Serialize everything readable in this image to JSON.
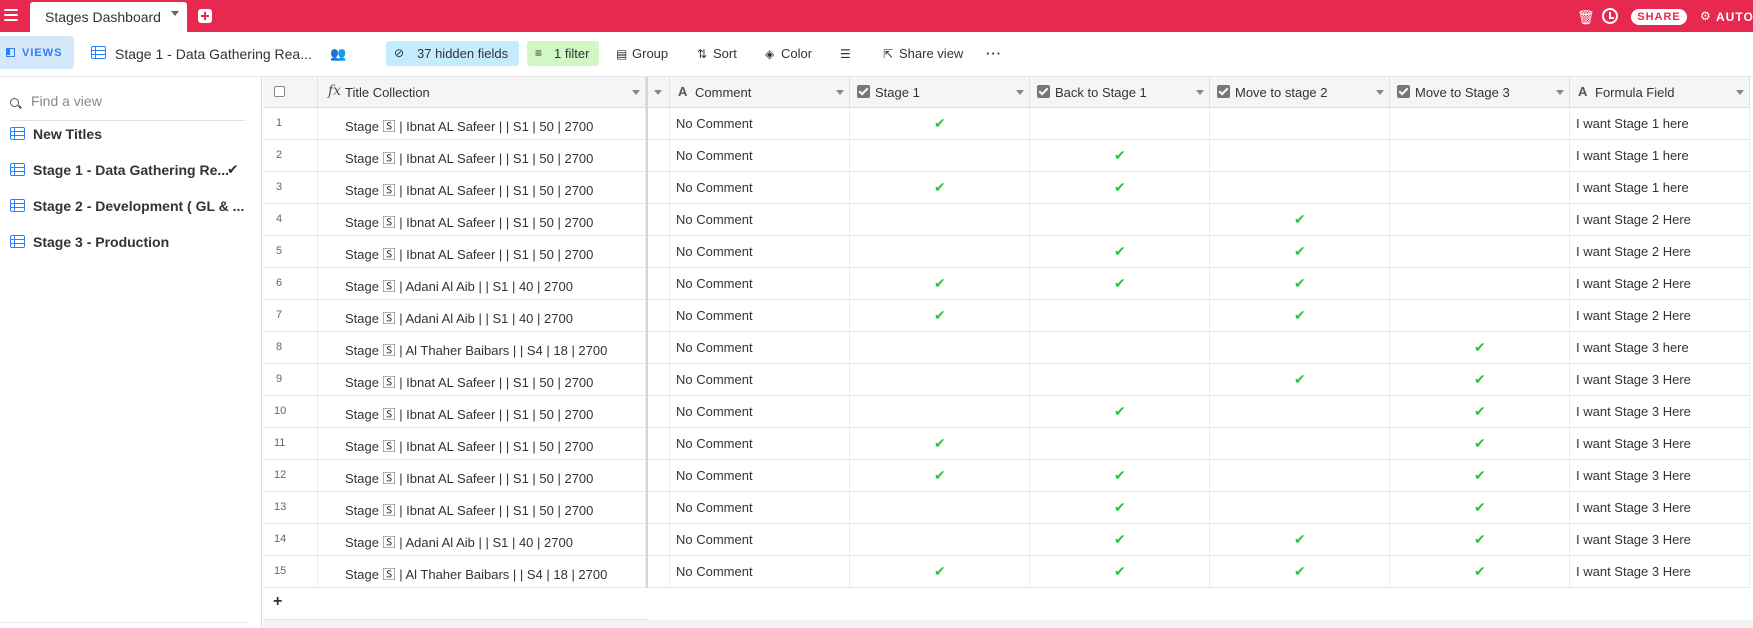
{
  "topbar": {
    "tab_title": "Stages Dashboard",
    "share_label": "SHARE",
    "auto_label": "AUTOM"
  },
  "toolbar": {
    "views_label": "VIEWS",
    "current_view": "Stage 1 - Data Gathering Rea...",
    "hidden_fields": "37 hidden fields",
    "filter": "1 filter",
    "group": "Group",
    "sort": "Sort",
    "color": "Color",
    "share_view": "Share view"
  },
  "sidebar": {
    "search_placeholder": "Find a view",
    "views": [
      {
        "label": "New Titles",
        "selected": false
      },
      {
        "label": "Stage 1 - Data Gathering Re...",
        "selected": true
      },
      {
        "label": "Stage 2 - Development ( GL & ...",
        "selected": false
      },
      {
        "label": "Stage 3 - Production",
        "selected": false
      }
    ]
  },
  "grid": {
    "columns": [
      "Title Collection",
      "Comment",
      "Stage 1",
      "Back to Stage 1",
      "Move to stage 2",
      "Move to Stage 3",
      "Formula Field"
    ],
    "rows": [
      {
        "num": "1",
        "title": "Stage 🅂 | Ibnat AL Safeer | | S1 | 50 | 2700",
        "comment": "No Comment",
        "s1": true,
        "back": false,
        "s2": false,
        "s3": false,
        "formula": "I want Stage 1 here"
      },
      {
        "num": "2",
        "title": "Stage 🅂 | Ibnat AL Safeer | | S1 | 50 | 2700",
        "comment": "No Comment",
        "s1": false,
        "back": true,
        "s2": false,
        "s3": false,
        "formula": "I want Stage 1 here"
      },
      {
        "num": "3",
        "title": "Stage 🅂 | Ibnat AL Safeer | | S1 | 50 | 2700",
        "comment": "No Comment",
        "s1": true,
        "back": true,
        "s2": false,
        "s3": false,
        "formula": "I want Stage 1 here"
      },
      {
        "num": "4",
        "title": "Stage 🅂 | Ibnat AL Safeer | | S1 | 50 | 2700",
        "comment": "No Comment",
        "s1": false,
        "back": false,
        "s2": true,
        "s3": false,
        "formula": "I want Stage 2 Here"
      },
      {
        "num": "5",
        "title": "Stage 🅂 | Ibnat AL Safeer | | S1 | 50 | 2700",
        "comment": "No Comment",
        "s1": false,
        "back": true,
        "s2": true,
        "s3": false,
        "formula": "I want Stage 2 Here"
      },
      {
        "num": "6",
        "title": "Stage 🅂 | Adani Al Aib | | S1 | 40 | 2700",
        "comment": "No Comment",
        "s1": true,
        "back": true,
        "s2": true,
        "s3": false,
        "formula": "I want Stage 2 Here"
      },
      {
        "num": "7",
        "title": "Stage 🅂 | Adani Al Aib | | S1 | 40 | 2700",
        "comment": "No Comment",
        "s1": true,
        "back": false,
        "s2": true,
        "s3": false,
        "formula": "I want Stage 2 Here"
      },
      {
        "num": "8",
        "title": "Stage 🅂 | Al Thaher Baibars | | S4 | 18 | 2700",
        "comment": "No Comment",
        "s1": false,
        "back": false,
        "s2": false,
        "s3": true,
        "formula": "I want Stage 3 here"
      },
      {
        "num": "9",
        "title": "Stage 🅂 | Ibnat AL Safeer | | S1 | 50 | 2700",
        "comment": "No Comment",
        "s1": false,
        "back": false,
        "s2": true,
        "s3": true,
        "formula": "I want Stage 3 Here"
      },
      {
        "num": "10",
        "title": "Stage 🅂 | Ibnat AL Safeer | | S1 | 50 | 2700",
        "comment": "No Comment",
        "s1": false,
        "back": true,
        "s2": false,
        "s3": true,
        "formula": "I want Stage 3 Here"
      },
      {
        "num": "11",
        "title": "Stage 🅂 | Ibnat AL Safeer | | S1 | 50 | 2700",
        "comment": "No Comment",
        "s1": true,
        "back": false,
        "s2": false,
        "s3": true,
        "formula": "I want Stage 3 Here"
      },
      {
        "num": "12",
        "title": "Stage 🅂 | Ibnat AL Safeer | | S1 | 50 | 2700",
        "comment": "No Comment",
        "s1": true,
        "back": true,
        "s2": false,
        "s3": true,
        "formula": "I want Stage 3 Here"
      },
      {
        "num": "13",
        "title": "Stage 🅂 | Ibnat AL Safeer | | S1 | 50 | 2700",
        "comment": "No Comment",
        "s1": false,
        "back": true,
        "s2": false,
        "s3": true,
        "formula": "I want Stage 3 Here"
      },
      {
        "num": "14",
        "title": "Stage 🅂 | Adani Al Aib | | S1 | 40 | 2700",
        "comment": "No Comment",
        "s1": false,
        "back": true,
        "s2": true,
        "s3": true,
        "formula": "I want Stage 3 Here"
      },
      {
        "num": "15",
        "title": "Stage 🅂 | Al Thaher Baibars | | S4 | 18 | 2700",
        "comment": "No Comment",
        "s1": true,
        "back": true,
        "s2": true,
        "s3": true,
        "formula": "I want Stage 3 Here"
      }
    ],
    "add_row_label": "+"
  },
  "colors": {
    "brand": "#e8294f",
    "accent": "#2d7ff9",
    "check": "#20c933"
  }
}
